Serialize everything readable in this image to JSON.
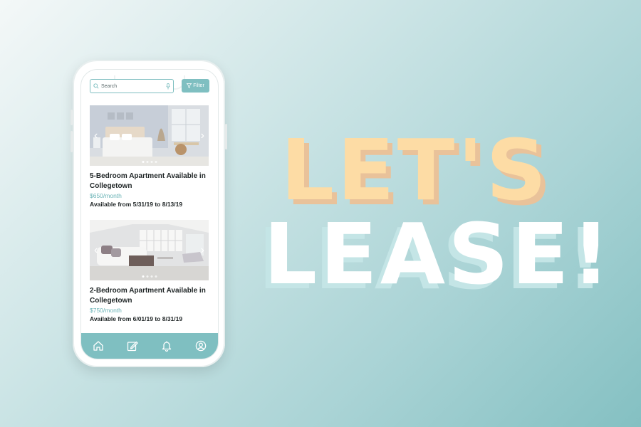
{
  "app": {
    "search": {
      "placeholder": "Search"
    },
    "filter_label": "Filter",
    "listings": [
      {
        "title": "5-Bedroom Apartment Available in Collegetown",
        "price": "$650/month",
        "availability": "Available from 5/31/19 to 8/13/19"
      },
      {
        "title": "2-Bedroom Apartment Available in Collegetown",
        "price": "$750/month",
        "availability": "Available from 6/01/19 to 8/31/19"
      }
    ],
    "nav_items": [
      "home-icon",
      "edit-icon",
      "bell-icon",
      "profile-icon"
    ]
  },
  "headline": {
    "line1": "LET'S",
    "line2": "LEASE!"
  },
  "colors": {
    "accent": "#7fbfc1",
    "price": "#6cb4b7",
    "headline_peach": "#fddca5",
    "headline_white": "#ffffff"
  }
}
